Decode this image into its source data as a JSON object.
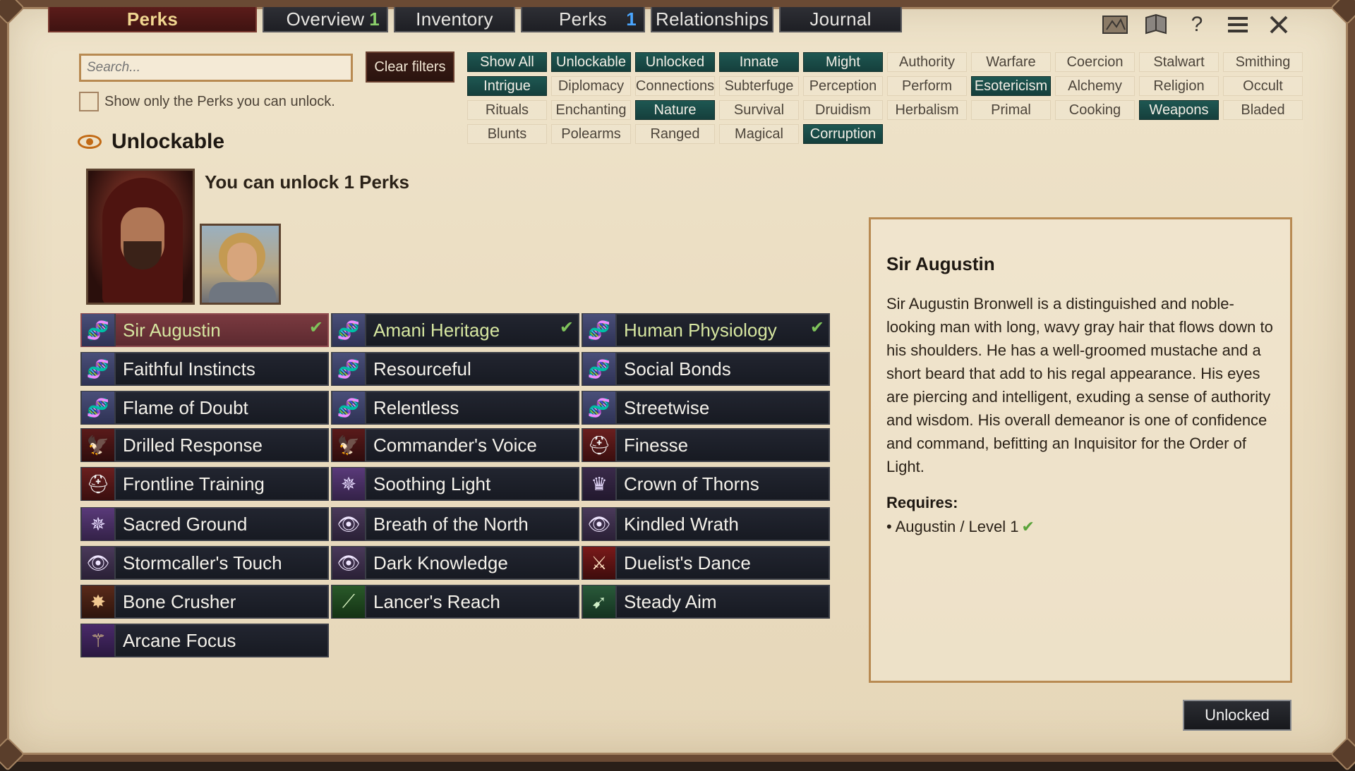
{
  "window": {
    "title": "Perks"
  },
  "tabs": [
    {
      "label": "Overview",
      "badge": "1"
    },
    {
      "label": "Inventory",
      "badge": ""
    },
    {
      "label": "Perks",
      "badge": "1"
    },
    {
      "label": "Relationships",
      "badge": ""
    },
    {
      "label": "Journal",
      "badge": ""
    }
  ],
  "search": {
    "placeholder": "Search...",
    "value": ""
  },
  "clear_filters_label": "Clear filters",
  "show_unlockable_label": "Show only the Perks you can unlock.",
  "filters": [
    {
      "label": "Show All",
      "on": true
    },
    {
      "label": "Unlockable",
      "on": true
    },
    {
      "label": "Unlocked",
      "on": true
    },
    {
      "label": "Innate",
      "on": true
    },
    {
      "label": "Might",
      "on": true
    },
    {
      "label": "Authority",
      "on": false
    },
    {
      "label": "Warfare",
      "on": false
    },
    {
      "label": "Coercion",
      "on": false
    },
    {
      "label": "Stalwart",
      "on": false
    },
    {
      "label": "Smithing",
      "on": false
    },
    {
      "label": "Intrigue",
      "on": true
    },
    {
      "label": "Diplomacy",
      "on": false
    },
    {
      "label": "Connections",
      "on": false
    },
    {
      "label": "Subterfuge",
      "on": false
    },
    {
      "label": "Perception",
      "on": false
    },
    {
      "label": "Perform",
      "on": false
    },
    {
      "label": "Esotericism",
      "on": true
    },
    {
      "label": "Alchemy",
      "on": false
    },
    {
      "label": "Religion",
      "on": false
    },
    {
      "label": "Occult",
      "on": false
    },
    {
      "label": "Rituals",
      "on": false
    },
    {
      "label": "Enchanting",
      "on": false
    },
    {
      "label": "Nature",
      "on": true
    },
    {
      "label": "Survival",
      "on": false
    },
    {
      "label": "Druidism",
      "on": false
    },
    {
      "label": "Herbalism",
      "on": false
    },
    {
      "label": "Primal",
      "on": false
    },
    {
      "label": "Cooking",
      "on": false
    },
    {
      "label": "Weapons",
      "on": true
    },
    {
      "label": "Bladed",
      "on": false
    },
    {
      "label": "Blunts",
      "on": false
    },
    {
      "label": "Polearms",
      "on": false
    },
    {
      "label": "Ranged",
      "on": false
    },
    {
      "label": "Magical",
      "on": false
    },
    {
      "label": "Corruption",
      "on": true
    }
  ],
  "section": {
    "title": "Unlockable",
    "count_text": "You can unlock 1 Perks"
  },
  "perk_columns": [
    [
      {
        "name": "Sir Augustin",
        "icon": "dna-icon",
        "checked": true,
        "selected": true
      },
      {
        "name": "Faithful Instincts",
        "icon": "dna-icon"
      },
      {
        "name": "Flame of Doubt",
        "icon": "dna-icon"
      },
      {
        "name": "Drilled Response",
        "icon": "eagle-icon"
      },
      {
        "name": "Frontline Training",
        "icon": "helmet-icon"
      },
      {
        "name": "Sacred Ground",
        "icon": "holy-symbol-icon"
      },
      {
        "name": "Stormcaller's Touch",
        "icon": "eye-icon"
      },
      {
        "name": "Bone Crusher",
        "icon": "mace-icon"
      },
      {
        "name": "Arcane Focus",
        "icon": "staff-icon"
      }
    ],
    [
      {
        "name": "Amani Heritage",
        "icon": "dna-icon",
        "checked": true
      },
      {
        "name": "Resourceful",
        "icon": "dna-icon"
      },
      {
        "name": "Relentless",
        "icon": "dna-icon"
      },
      {
        "name": "Commander's Voice",
        "icon": "eagle-icon"
      },
      {
        "name": "Soothing Light",
        "icon": "holy-symbol-icon"
      },
      {
        "name": "Breath of the North",
        "icon": "eye-icon"
      },
      {
        "name": "Dark Knowledge",
        "icon": "eye-icon"
      },
      {
        "name": "Lancer's Reach",
        "icon": "spear-icon"
      }
    ],
    [
      {
        "name": "Human Physiology",
        "icon": "dna-icon",
        "checked": true
      },
      {
        "name": "Social Bonds",
        "icon": "dna-icon"
      },
      {
        "name": "Streetwise",
        "icon": "dna-icon"
      },
      {
        "name": "Finesse",
        "icon": "helmet-icon"
      },
      {
        "name": "Crown of Thorns",
        "icon": "crown-icon"
      },
      {
        "name": "Kindled Wrath",
        "icon": "eye-icon"
      },
      {
        "name": "Duelist's Dance",
        "icon": "sword-icon"
      },
      {
        "name": "Steady Aim",
        "icon": "bow-icon"
      }
    ]
  ],
  "detail": {
    "title": "Sir Augustin",
    "description": "Sir Augustin Bronwell is a distinguished and noble-looking man with long, wavy gray hair that flows down to his shoulders. He has a well-groomed mustache and a short beard that add to his regal appearance. His eyes are piercing and intelligent, exuding a sense of authority and wisdom. His overall demeanor is one of confidence and command, befitting an Inquisitor for the Order of Light.",
    "requires_label": "Requires:",
    "requirement": "Augustin / Level 1"
  },
  "status_button_label": "Unlocked"
}
